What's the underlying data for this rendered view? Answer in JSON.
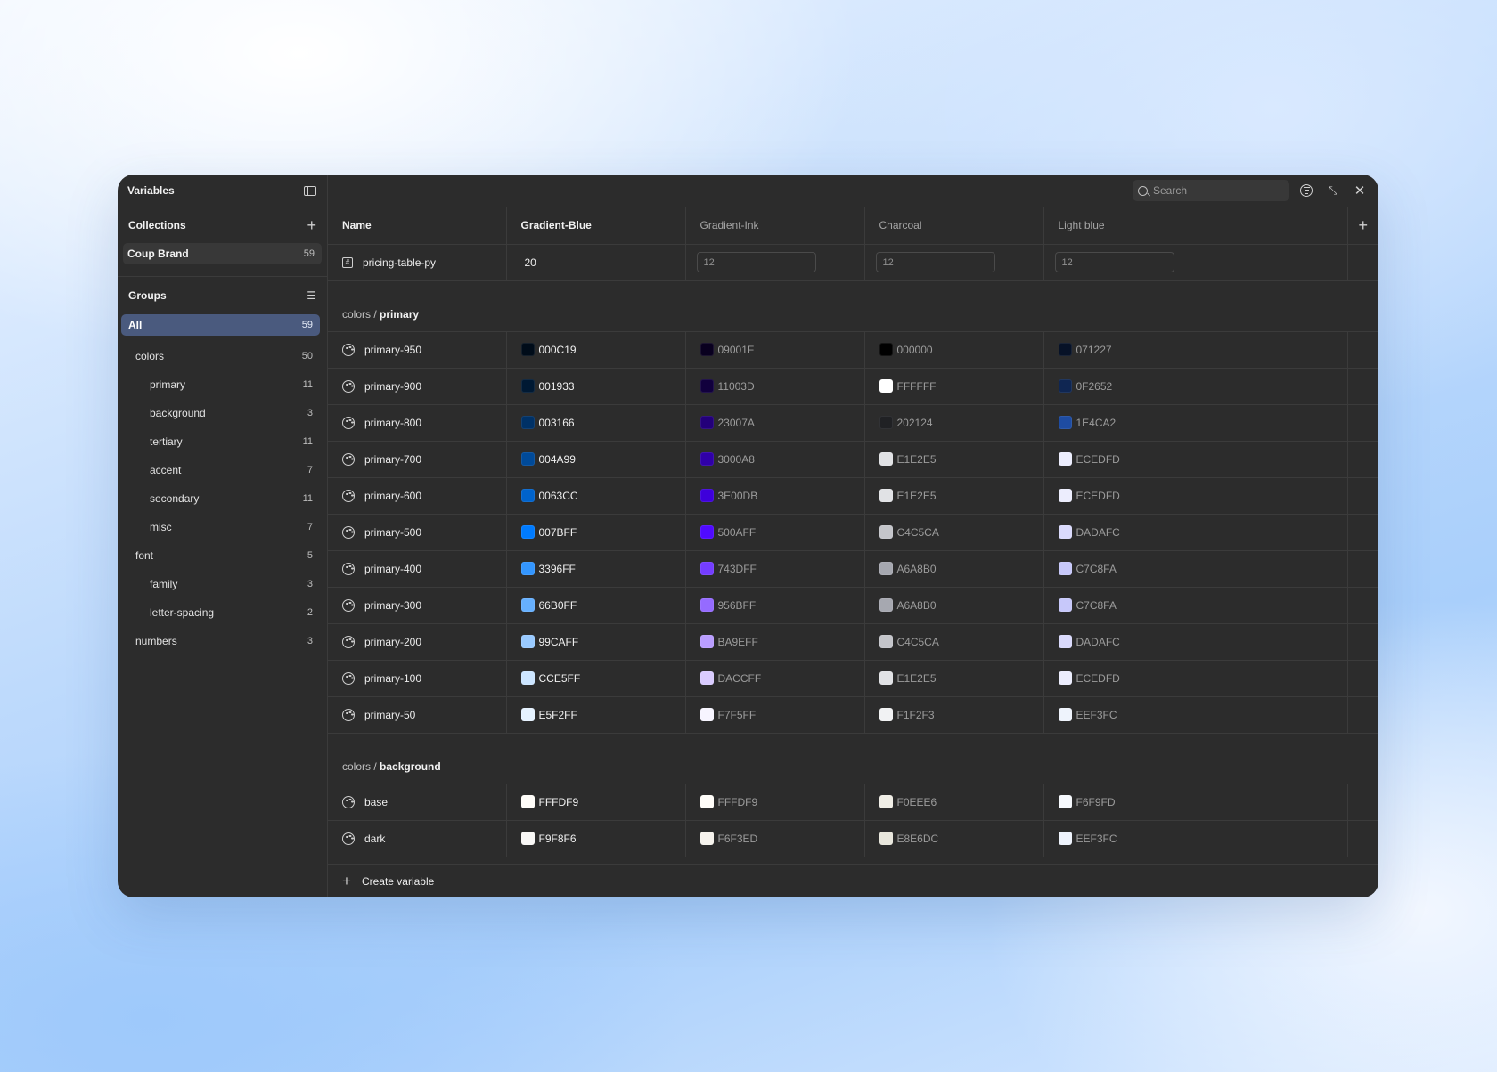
{
  "window": {
    "title": "Variables"
  },
  "sidebar": {
    "collections_label": "Collections",
    "collections": [
      {
        "name": "Coup Brand",
        "count": "59"
      }
    ],
    "groups_label": "Groups",
    "groups": [
      {
        "name": "All",
        "count": "59",
        "level": 0,
        "active": true
      },
      {
        "name": "colors",
        "count": "50",
        "level": 1
      },
      {
        "name": "primary",
        "count": "11",
        "level": 2
      },
      {
        "name": "background",
        "count": "3",
        "level": 2
      },
      {
        "name": "tertiary",
        "count": "11",
        "level": 2
      },
      {
        "name": "accent",
        "count": "7",
        "level": 2
      },
      {
        "name": "secondary",
        "count": "11",
        "level": 2
      },
      {
        "name": "misc",
        "count": "7",
        "level": 2
      },
      {
        "name": "font",
        "count": "5",
        "level": 1
      },
      {
        "name": "family",
        "count": "3",
        "level": 2
      },
      {
        "name": "letter-spacing",
        "count": "2",
        "level": 2
      },
      {
        "name": "numbers",
        "count": "3",
        "level": 1
      }
    ]
  },
  "topbar": {
    "search_placeholder": "Search"
  },
  "table": {
    "columns": [
      "Name",
      "Gradient-Blue",
      "Gradient-Ink",
      "Charcoal",
      "Light blue"
    ],
    "number_row": {
      "name": "pricing-table-py",
      "values": [
        "20",
        "12",
        "12",
        "12"
      ]
    },
    "groups": [
      {
        "path": "colors / ",
        "group": "primary",
        "rows": [
          {
            "name": "primary-950",
            "values": [
              "000C19",
              "09001F",
              "000000",
              "071227"
            ]
          },
          {
            "name": "primary-900",
            "values": [
              "001933",
              "11003D",
              "FFFFFF",
              "0F2652"
            ]
          },
          {
            "name": "primary-800",
            "values": [
              "003166",
              "23007A",
              "202124",
              "1E4CA2"
            ]
          },
          {
            "name": "primary-700",
            "values": [
              "004A99",
              "3000A8",
              "E1E2E5",
              "ECEDFD"
            ]
          },
          {
            "name": "primary-600",
            "values": [
              "0063CC",
              "3E00DB",
              "E1E2E5",
              "ECEDFD"
            ]
          },
          {
            "name": "primary-500",
            "values": [
              "007BFF",
              "500AFF",
              "C4C5CA",
              "DADAFC"
            ]
          },
          {
            "name": "primary-400",
            "values": [
              "3396FF",
              "743DFF",
              "A6A8B0",
              "C7C8FA"
            ]
          },
          {
            "name": "primary-300",
            "values": [
              "66B0FF",
              "956BFF",
              "A6A8B0",
              "C7C8FA"
            ]
          },
          {
            "name": "primary-200",
            "values": [
              "99CAFF",
              "BA9EFF",
              "C4C5CA",
              "DADAFC"
            ]
          },
          {
            "name": "primary-100",
            "values": [
              "CCE5FF",
              "DACCFF",
              "E1E2E5",
              "ECEDFD"
            ]
          },
          {
            "name": "primary-50",
            "values": [
              "E5F2FF",
              "F7F5FF",
              "F1F2F3",
              "EEF3FC"
            ]
          }
        ]
      },
      {
        "path": "colors / ",
        "group": "background",
        "rows": [
          {
            "name": "base",
            "values": [
              "FFFDF9",
              "FFFDF9",
              "F0EEE6",
              "F6F9FD"
            ]
          },
          {
            "name": "dark",
            "values": [
              "F9F8F6",
              "F6F3ED",
              "E8E6DC",
              "EEF3FC"
            ]
          }
        ]
      }
    ]
  },
  "footer": {
    "create_label": "Create variable"
  }
}
